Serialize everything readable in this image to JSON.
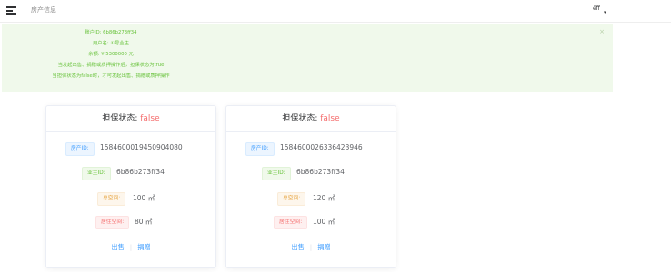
{
  "header": {
    "breadcrumb": "房产信息",
    "user_name": "ёff",
    "dropdown_caret": "▾"
  },
  "alert": {
    "lines": [
      "账户ID: 6b86b273ff34",
      "用户名: ①号业主",
      "余额: ¥ 5300000 元",
      "当发起出售、捐赠或质押操作后，担保状态为true",
      "当担保状态为false时，才可发起出售、捐赠或质押操作"
    ],
    "close_glyph": "×"
  },
  "labels": {
    "status_label": "担保状态: ",
    "property_id": "房产ID:",
    "owner_id": "业主ID:",
    "total_area": "总空间:",
    "living_area": "居住空间:",
    "sell": "出售",
    "donate": "捐赠",
    "separator": "|"
  },
  "properties": [
    {
      "status": "false",
      "property_id": "1584600019450904080",
      "owner_id": "6b86b273ff34",
      "total_area": "100 ㎡",
      "living_area": "80 ㎡"
    },
    {
      "status": "false",
      "property_id": "1584600026336423946",
      "owner_id": "6b86b273ff34",
      "total_area": "120 ㎡",
      "living_area": "100 ㎡"
    }
  ],
  "colors": {
    "alert_bg": "#f0f9eb",
    "alert_text": "#67c23a",
    "status_false": "#f56c6c",
    "link": "#409eff"
  },
  "icons": {
    "menu": "hamburger-menu-icon",
    "close": "close-icon",
    "caret": "caret-down-icon"
  }
}
